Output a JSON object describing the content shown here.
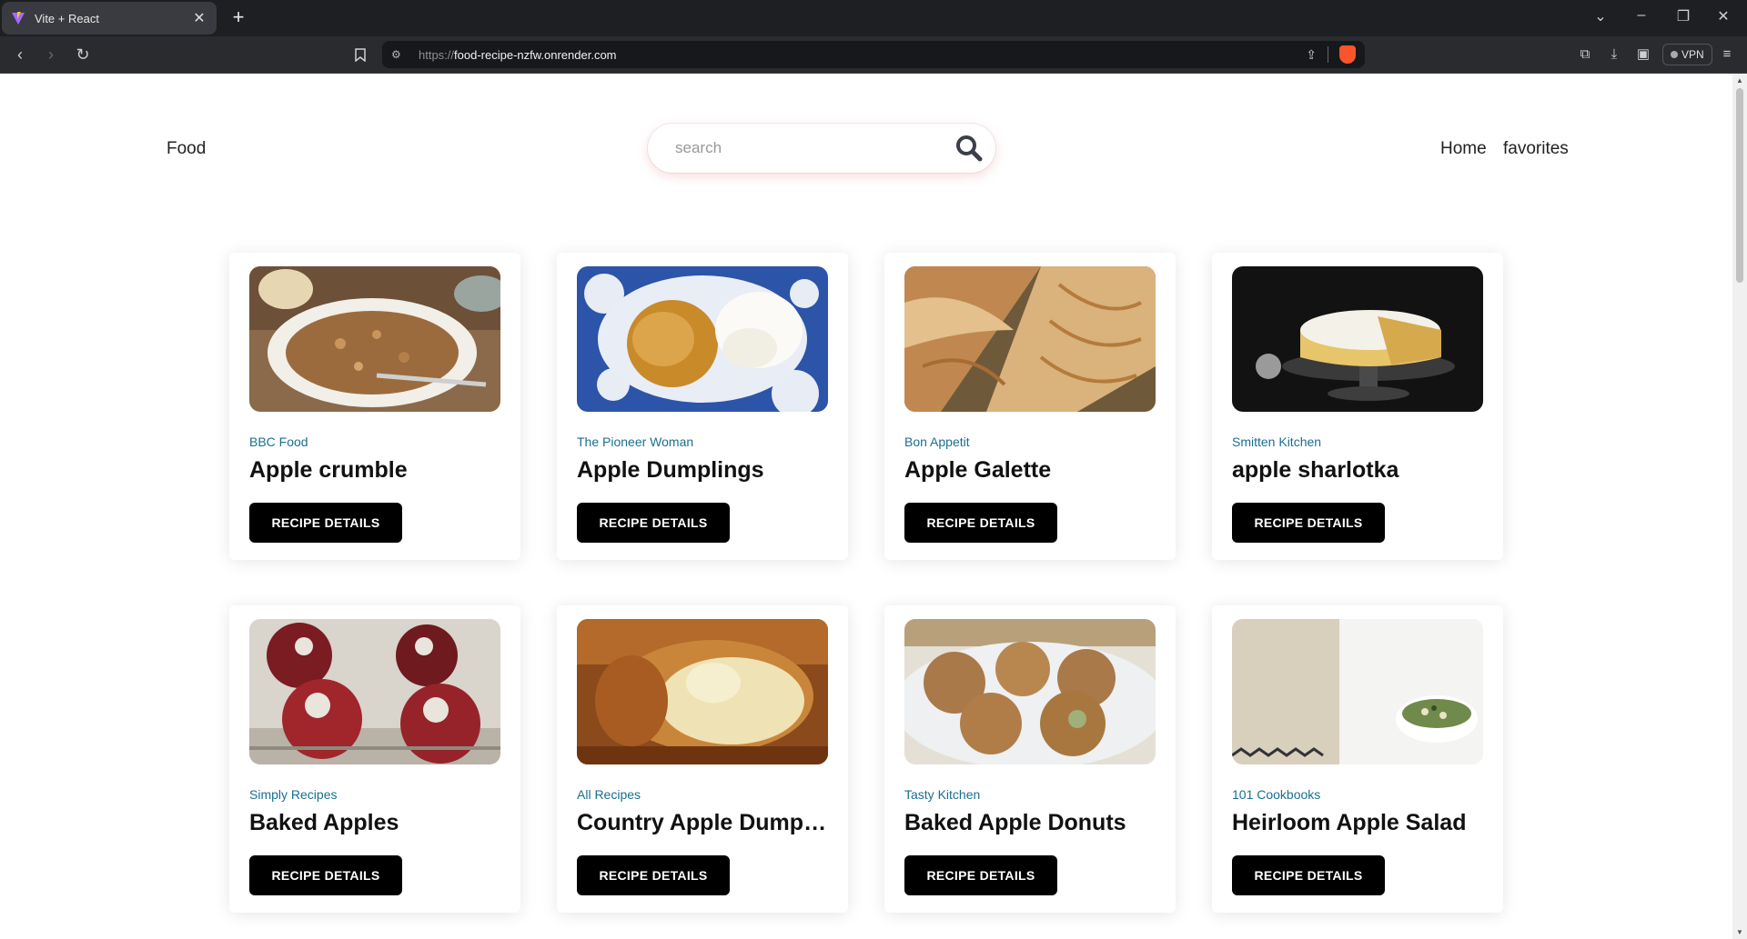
{
  "browser": {
    "tab_title": "Vite + React",
    "url_scheme": "https://",
    "url_host": "food-recipe-nzfw.onrender.com",
    "vpn_label": "VPN"
  },
  "header": {
    "logo": "Food",
    "search_placeholder": "search",
    "nav_home": "Home",
    "nav_favorites": "favorites"
  },
  "recipes": [
    {
      "publisher": "BBC Food",
      "title": "Apple crumble",
      "button": "RECIPE DETAILS",
      "image": "apple-crumble-photo"
    },
    {
      "publisher": "The Pioneer Woman",
      "title": "Apple Dumplings",
      "button": "RECIPE DETAILS",
      "image": "apple-dumplings-photo"
    },
    {
      "publisher": "Bon Appetit",
      "title": "Apple Galette",
      "button": "RECIPE DETAILS",
      "image": "apple-galette-photo"
    },
    {
      "publisher": "Smitten Kitchen",
      "title": "apple sharlotka",
      "button": "RECIPE DETAILS",
      "image": "apple-sharlotka-photo"
    },
    {
      "publisher": "Simply Recipes",
      "title": "Baked Apples",
      "button": "RECIPE DETAILS",
      "image": "baked-apples-photo"
    },
    {
      "publisher": "All Recipes",
      "title": "Country Apple Dumpli...",
      "button": "RECIPE DETAILS",
      "image": "country-apple-dumplings-photo"
    },
    {
      "publisher": "Tasty Kitchen",
      "title": "Baked Apple Donuts",
      "button": "RECIPE DETAILS",
      "image": "baked-apple-donuts-photo"
    },
    {
      "publisher": "101 Cookbooks",
      "title": "Heirloom Apple Salad",
      "button": "RECIPE DETAILS",
      "image": "heirloom-apple-salad-photo"
    }
  ],
  "colors": {
    "publisher_text": "#1a6f8f",
    "button_bg": "#000000",
    "button_text": "#ffffff",
    "browser_chrome": "#1e1f23"
  }
}
